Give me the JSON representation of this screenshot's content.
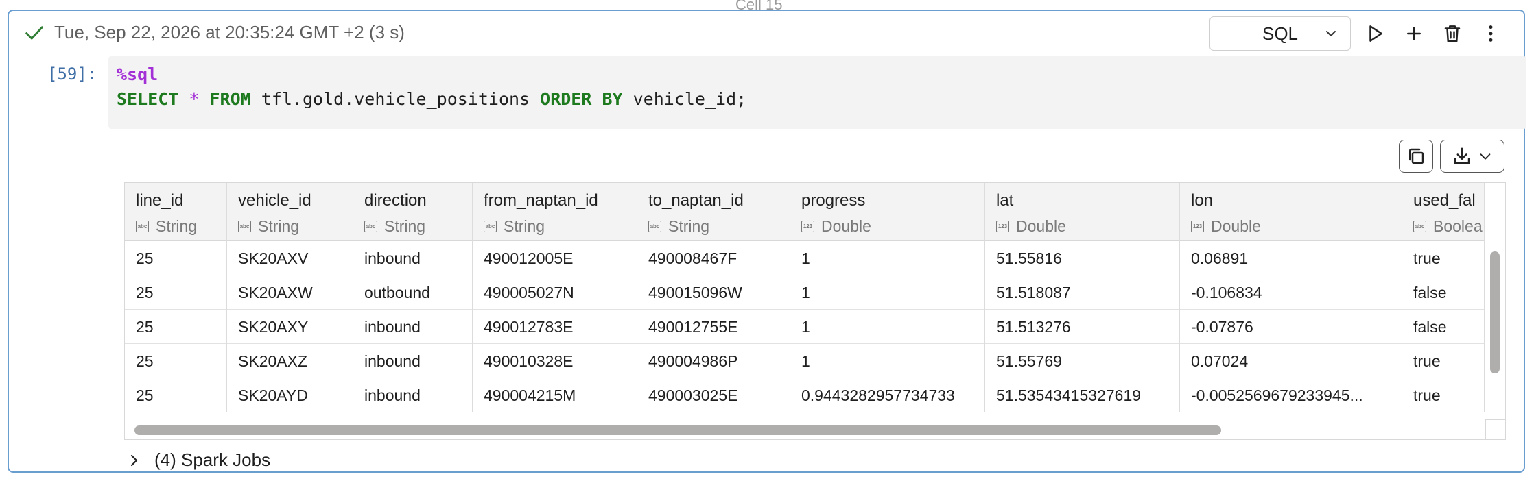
{
  "cell": {
    "title": "Cell 15",
    "status": "Tue, Sep 22, 2026 at 20:35:24 GMT +2 (3 s)",
    "language": "SQL",
    "execution_count": "[59]:"
  },
  "code": {
    "magic": "%sql",
    "tokens": [
      {
        "t": "SELECT",
        "c": "kw"
      },
      {
        "t": " ",
        "c": "plain"
      },
      {
        "t": "*",
        "c": "op"
      },
      {
        "t": " ",
        "c": "plain"
      },
      {
        "t": "FROM",
        "c": "kw"
      },
      {
        "t": " tfl.gold.vehicle_positions ",
        "c": "plain"
      },
      {
        "t": "ORDER BY",
        "c": "kw"
      },
      {
        "t": " vehicle_id;",
        "c": "plain"
      }
    ]
  },
  "table": {
    "columns": [
      {
        "name": "line_id",
        "type": "String",
        "icon": "abc"
      },
      {
        "name": "vehicle_id",
        "type": "String",
        "icon": "abc"
      },
      {
        "name": "direction",
        "type": "String",
        "icon": "abc"
      },
      {
        "name": "from_naptan_id",
        "type": "String",
        "icon": "abc"
      },
      {
        "name": "to_naptan_id",
        "type": "String",
        "icon": "abc"
      },
      {
        "name": "progress",
        "type": "Double",
        "icon": "123"
      },
      {
        "name": "lat",
        "type": "Double",
        "icon": "123"
      },
      {
        "name": "lon",
        "type": "Double",
        "icon": "123"
      },
      {
        "name": "used_fal",
        "type": "Boolea",
        "icon": "abc"
      }
    ],
    "rows": [
      [
        "25",
        "SK20AXV",
        "inbound",
        "490012005E",
        "490008467F",
        "1",
        "51.55816",
        "0.06891",
        "true"
      ],
      [
        "25",
        "SK20AXW",
        "outbound",
        "490005027N",
        "490015096W",
        "1",
        "51.518087",
        "-0.106834",
        "false"
      ],
      [
        "25",
        "SK20AXY",
        "inbound",
        "490012783E",
        "490012755E",
        "1",
        "51.513276",
        "-0.07876",
        "false"
      ],
      [
        "25",
        "SK20AXZ",
        "inbound",
        "490010328E",
        "490004986P",
        "1",
        "51.55769",
        "0.07024",
        "true"
      ],
      [
        "25",
        "SK20AYD",
        "inbound",
        "490004215M",
        "490003025E",
        "0.9443282957734733",
        "51.53543415327619",
        "-0.0052569679233945...",
        "true"
      ]
    ]
  },
  "spark_jobs": "(4) Spark Jobs",
  "icons": {
    "status": "check-icon",
    "language_dropdown": "chevron-down-icon",
    "run": "play-icon",
    "add": "plus-icon",
    "delete": "trash-icon",
    "more": "kebab-menu-icon",
    "copy": "copy-icon",
    "download": "download-icon",
    "expand": "chevron-right-icon"
  },
  "colors": {
    "success": "#2e7d32",
    "cell_border": "#6b9ed0",
    "keyword": "#1e7a1e",
    "magic": "#a32fd6"
  }
}
